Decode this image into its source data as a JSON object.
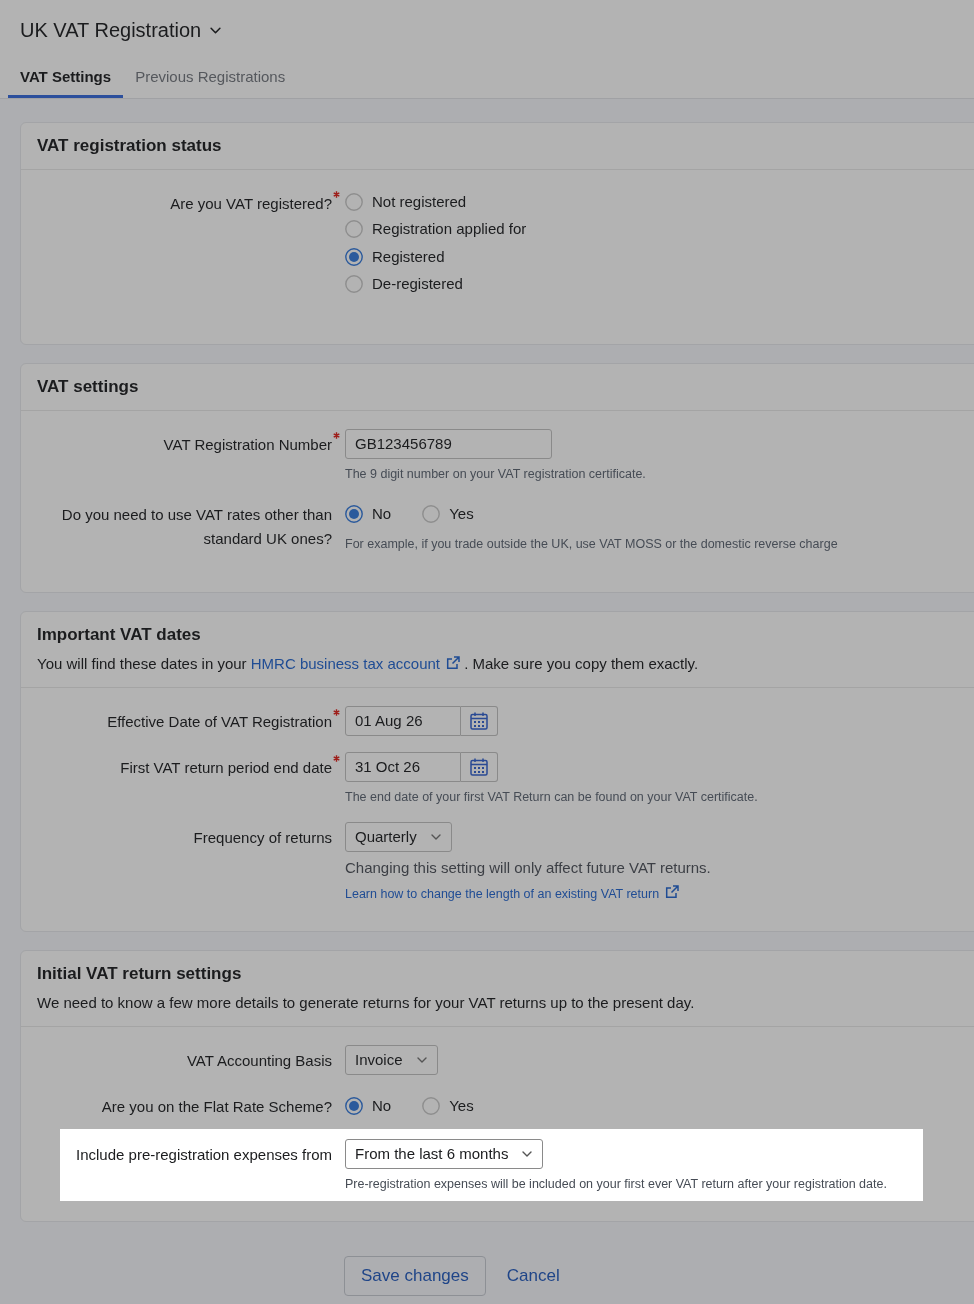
{
  "page_title": "UK VAT Registration",
  "tabs": [
    {
      "label": "VAT Settings",
      "selected": true
    },
    {
      "label": "Previous Registrations",
      "selected": false
    }
  ],
  "sections": [
    {
      "title": "VAT registration status",
      "fields": [
        {
          "kind": "radio_list",
          "label": "Are you VAT registered?",
          "required": true,
          "highlighted": false,
          "options": [
            {
              "label": "Not registered",
              "selected": false
            },
            {
              "label": "Registration applied for",
              "selected": false
            },
            {
              "label": "Registered",
              "selected": true
            },
            {
              "label": "De-registered",
              "selected": false
            }
          ]
        }
      ]
    },
    {
      "title": "VAT settings",
      "fields": [
        {
          "kind": "text",
          "label": "VAT Registration Number",
          "required": true,
          "highlighted": false,
          "value": "GB123456789",
          "notes": [
            {
              "kind": "hint",
              "text": "The 9 digit number on your VAT registration certificate."
            }
          ]
        },
        {
          "kind": "radio_inline",
          "label": "Do you need to use VAT rates other than standard UK ones?",
          "required": false,
          "highlighted": false,
          "options": [
            {
              "label": "No",
              "selected": true
            },
            {
              "label": "Yes",
              "selected": false
            }
          ],
          "notes": [
            {
              "kind": "hint",
              "text": "For example, if you trade outside the UK, use VAT MOSS or the domestic reverse charge"
            }
          ]
        }
      ]
    },
    {
      "title": "Important VAT dates",
      "intro": [
        {
          "kind": "text",
          "text": "You will find these dates in your"
        },
        {
          "kind": "link",
          "text": "HMRC business tax account"
        },
        {
          "kind": "text",
          "text": ". Make sure you copy them exactly."
        }
      ],
      "fields": [
        {
          "kind": "date",
          "label": "Effective Date of VAT Registration",
          "required": true,
          "highlighted": false,
          "value": "01 Aug 26"
        },
        {
          "kind": "date",
          "label": "First VAT return period end date",
          "required": true,
          "highlighted": false,
          "value": "31 Oct 26",
          "notes": [
            {
              "kind": "hint",
              "text": "The end date of your first VAT Return can be found on your VAT certificate."
            }
          ]
        },
        {
          "kind": "select",
          "label": "Frequency of returns",
          "required": false,
          "highlighted": false,
          "value": "Quarterly",
          "notes": [
            {
              "kind": "note",
              "text": "Changing this setting will only affect future VAT returns."
            },
            {
              "kind": "link",
              "text": "Learn how to change the length of an existing VAT return"
            }
          ]
        }
      ]
    },
    {
      "title": "Initial VAT return settings",
      "intro": [
        {
          "kind": "text",
          "text": "We need to know a few more details to generate returns for your VAT returns up to the present day."
        }
      ],
      "fields": [
        {
          "kind": "select",
          "label": "VAT Accounting Basis",
          "required": false,
          "highlighted": false,
          "value": "Invoice"
        },
        {
          "kind": "radio_inline",
          "label": "Are you on the Flat Rate Scheme?",
          "required": false,
          "highlighted": false,
          "options": [
            {
              "label": "No",
              "selected": true
            },
            {
              "label": "Yes",
              "selected": false
            }
          ]
        },
        {
          "kind": "select",
          "label": "Include pre-registration expenses from",
          "required": false,
          "highlighted": true,
          "value": "From the last 6 months",
          "notes": [
            {
              "kind": "hint",
              "text": "Pre-registration expenses will be included on your first ever VAT return after your registration date."
            }
          ]
        }
      ]
    }
  ],
  "buttons": [
    {
      "kind": "outlined",
      "label": "Save changes"
    },
    {
      "kind": "link",
      "label": "Cancel"
    }
  ]
}
